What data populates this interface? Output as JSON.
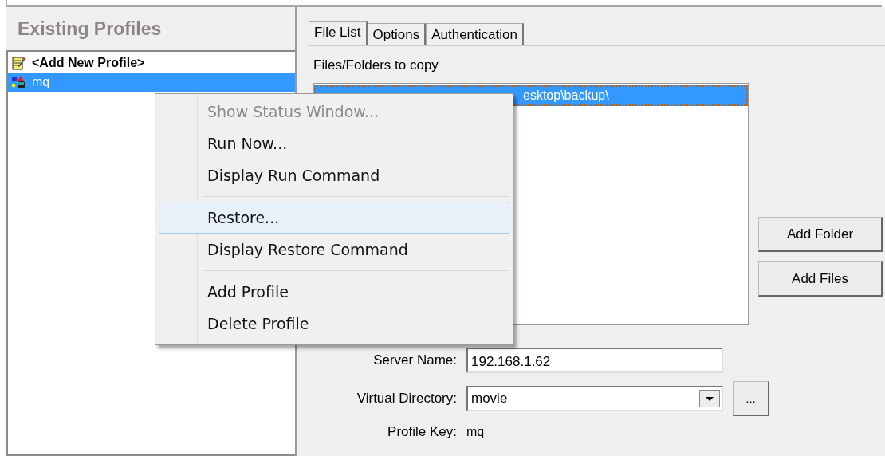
{
  "profiles_panel": {
    "title": "Existing Profiles",
    "items": [
      {
        "label": "<Add New Profile>",
        "kind": "new",
        "selected": false
      },
      {
        "label": "mq",
        "kind": "profile",
        "selected": true
      }
    ]
  },
  "tabs": [
    {
      "label": "File List",
      "selected": true
    },
    {
      "label": "Options",
      "selected": false
    },
    {
      "label": "Authentication",
      "selected": false
    }
  ],
  "file_list": {
    "label": "Files/Folders to copy",
    "items": [
      {
        "path": "esktop\\backup\\",
        "selected": true
      }
    ]
  },
  "buttons": [
    "Add Folder",
    "Add Files"
  ],
  "server_name": {
    "label": "Server Name:",
    "value": "192.168.1.62"
  },
  "virtual_directory": {
    "label": "Virtual Directory:",
    "value": "movie",
    "browse": "..."
  },
  "profile_key": {
    "label": "Profile Key:",
    "value": "mq"
  },
  "context_menu": [
    {
      "kind": "item",
      "label": "Show Status Window...",
      "disabled": true,
      "selected": false
    },
    {
      "kind": "item",
      "label": "Run Now...",
      "disabled": false,
      "selected": false
    },
    {
      "kind": "item",
      "label": "Display Run Command",
      "disabled": false,
      "selected": false
    },
    {
      "kind": "separator"
    },
    {
      "kind": "item",
      "label": "Restore...",
      "disabled": false,
      "selected": true
    },
    {
      "kind": "item",
      "label": "Display Restore Command",
      "disabled": false,
      "selected": false
    },
    {
      "kind": "separator"
    },
    {
      "kind": "item",
      "label": "Add Profile",
      "disabled": false,
      "selected": false
    },
    {
      "kind": "item",
      "label": "Delete Profile",
      "disabled": false,
      "selected": false
    }
  ]
}
